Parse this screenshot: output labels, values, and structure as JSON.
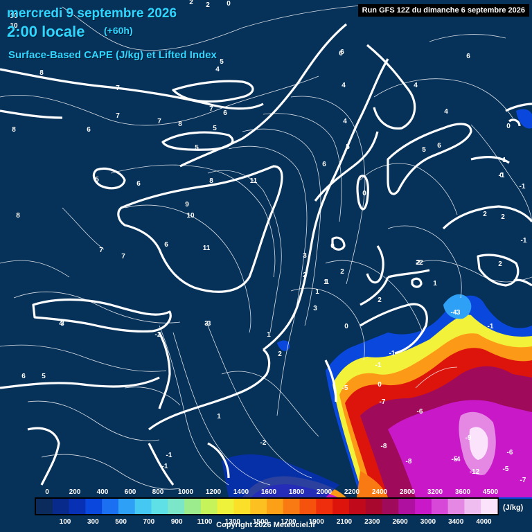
{
  "header": {
    "date": "mercredi 9 septembre 2026",
    "local_time": "2:00 locale",
    "lead": "(+60h)",
    "field": "Surface-Based CAPE (J/kg) et Lifted Index",
    "run": "Run GFS 12Z du dimanche 6 septembre 2026"
  },
  "legend": {
    "top_labels": [
      "0",
      "200",
      "400",
      "600",
      "800",
      "1000",
      "1200",
      "1400",
      "1600",
      "1800",
      "2000",
      "2200",
      "2400",
      "2800",
      "3200",
      "3600",
      "4500"
    ],
    "bottom_labels": [
      "100",
      "300",
      "500",
      "700",
      "900",
      "1100",
      "1300",
      "1500",
      "1700",
      "1900",
      "2100",
      "2300",
      "2600",
      "3000",
      "3400",
      "4000"
    ],
    "unit": "(J/kg)",
    "colors": [
      "#0b2b5c",
      "#082a8a",
      "#0730b5",
      "#0a48dd",
      "#1a70f0",
      "#2ea0f5",
      "#45c8f2",
      "#5fe0e6",
      "#7be6c8",
      "#9cec8e",
      "#c6f25a",
      "#eef23a",
      "#fbe02a",
      "#fcc020",
      "#fca018",
      "#f97a12",
      "#f5520e",
      "#ee2e0c",
      "#dc140c",
      "#c00a1c",
      "#a8082e",
      "#a00a5a",
      "#b010a0",
      "#c818c8",
      "#d848d8",
      "#e488e4",
      "#f0bdf0",
      "#fbe4fb"
    ]
  },
  "labels": {
    "lifted_index": [
      "2",
      "2",
      "0",
      "10",
      "10",
      "8",
      "8",
      "7",
      "6",
      "7",
      "7",
      "8",
      "6",
      "5",
      "5",
      "5",
      "7",
      "5",
      "6",
      "8",
      "8",
      "9",
      "10",
      "11",
      "11",
      "7",
      "7",
      "6",
      "6",
      "4",
      "5",
      "4",
      "3",
      "3",
      "3",
      "2",
      "1",
      "1",
      "1",
      "2",
      "2",
      "0",
      "0",
      "0",
      "-1",
      "-1",
      "2",
      "2",
      "2",
      "4",
      "5",
      "6",
      "6",
      "4",
      "4",
      "0",
      "0",
      "-1",
      "-1",
      "1",
      "1",
      "1",
      "2",
      "2",
      "-1",
      "-1",
      "-2",
      "-3",
      "-3",
      "-4",
      "-5",
      "-5",
      "-6",
      "-6",
      "-7",
      "-7",
      "-8",
      "-8",
      "-9",
      "-12",
      "-4",
      "-5",
      "-1",
      "-1",
      "-2",
      "3",
      "4",
      "5",
      "6",
      "6",
      "6",
      "0",
      "2",
      "2",
      "1"
    ],
    "copyright": "Copyright 2026 Meteociel.fr"
  }
}
